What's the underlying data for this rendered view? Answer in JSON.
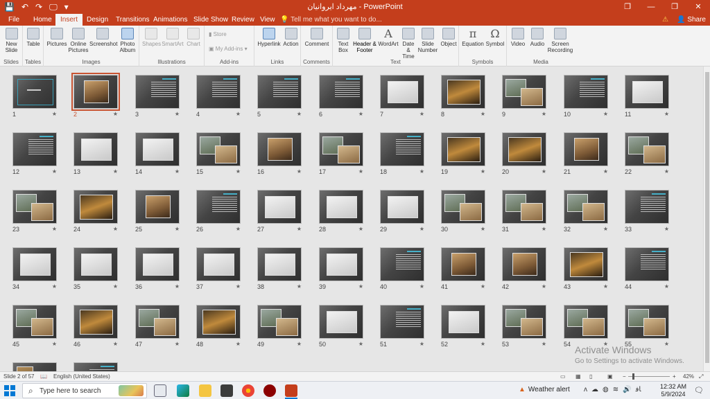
{
  "titlebar": {
    "title": "مهرداد ایروانیان - PowerPoint",
    "qat": [
      "💾",
      "↶",
      "↷",
      "🖵",
      "▾"
    ],
    "window_controls": [
      "❐",
      "—",
      "❐",
      "✕"
    ]
  },
  "tabs": [
    {
      "label": "File",
      "active": false
    },
    {
      "label": "Home",
      "active": false
    },
    {
      "label": "Insert",
      "active": true
    },
    {
      "label": "Design",
      "active": false
    },
    {
      "label": "Transitions",
      "active": false
    },
    {
      "label": "Animations",
      "active": false
    },
    {
      "label": "Slide Show",
      "active": false
    },
    {
      "label": "Review",
      "active": false
    },
    {
      "label": "View",
      "active": false
    }
  ],
  "tell_me": "Tell me what you want to do...",
  "share_label": "Share",
  "ribbon": {
    "new_slide": "New Slide",
    "table": "Table",
    "pictures": "Pictures",
    "online_pictures": "Online Pictures",
    "screenshot": "Screenshot",
    "photo_album": "Photo Album",
    "shapes": "Shapes",
    "smartart": "SmartArt",
    "chart": "Chart",
    "store": "Store",
    "my_addins": "My Add-ins",
    "hyperlink": "Hyperlink",
    "action": "Action",
    "comment": "Comment",
    "text_box": "Text Box",
    "header_footer": "Header & Footer",
    "wordart": "WordArt",
    "date_time": "Date & Time",
    "slide_number": "Slide Number",
    "object": "Object",
    "equation": "Equation",
    "symbol": "Symbol",
    "video": "Video",
    "audio": "Audio",
    "screen_recording": "Screen Recording",
    "groups": {
      "slides": "Slides",
      "tables": "Tables",
      "images": "Images",
      "illustrations": "Illustrations",
      "addins": "Add-ins",
      "links": "Links",
      "comments": "Comments",
      "text": "Text",
      "symbols": "Symbols",
      "media": "Media"
    }
  },
  "slides": [
    {
      "n": "1",
      "k": "frame"
    },
    {
      "n": "2",
      "k": "p1"
    },
    {
      "n": "3",
      "k": "text"
    },
    {
      "n": "4",
      "k": "text"
    },
    {
      "n": "5",
      "k": "text"
    },
    {
      "n": "6",
      "k": "title"
    },
    {
      "n": "7",
      "k": "p4"
    },
    {
      "n": "8",
      "k": "p5"
    },
    {
      "n": "9",
      "k": "two"
    },
    {
      "n": "10",
      "k": "text"
    },
    {
      "n": "11",
      "k": "p4"
    },
    {
      "n": "12",
      "k": "text"
    },
    {
      "n": "13",
      "k": "p4"
    },
    {
      "n": "14",
      "k": "p4"
    },
    {
      "n": "15",
      "k": "two"
    },
    {
      "n": "16",
      "k": "p1"
    },
    {
      "n": "17",
      "k": "two"
    },
    {
      "n": "18",
      "k": "title"
    },
    {
      "n": "19",
      "k": "p5"
    },
    {
      "n": "20",
      "k": "p5"
    },
    {
      "n": "21",
      "k": "p1"
    },
    {
      "n": "22",
      "k": "two"
    },
    {
      "n": "23",
      "k": "two"
    },
    {
      "n": "24",
      "k": "p5"
    },
    {
      "n": "25",
      "k": "p1"
    },
    {
      "n": "26",
      "k": "text"
    },
    {
      "n": "27",
      "k": "p4"
    },
    {
      "n": "28",
      "k": "p4"
    },
    {
      "n": "29",
      "k": "p4"
    },
    {
      "n": "30",
      "k": "two"
    },
    {
      "n": "31",
      "k": "two"
    },
    {
      "n": "32",
      "k": "two"
    },
    {
      "n": "33",
      "k": "text"
    },
    {
      "n": "34",
      "k": "p4"
    },
    {
      "n": "35",
      "k": "p4"
    },
    {
      "n": "36",
      "k": "p4"
    },
    {
      "n": "37",
      "k": "p4"
    },
    {
      "n": "38",
      "k": "p4"
    },
    {
      "n": "39",
      "k": "p4"
    },
    {
      "n": "40",
      "k": "text"
    },
    {
      "n": "41",
      "k": "p1"
    },
    {
      "n": "42",
      "k": "p1"
    },
    {
      "n": "43",
      "k": "p5"
    },
    {
      "n": "44",
      "k": "text"
    },
    {
      "n": "45",
      "k": "two"
    },
    {
      "n": "46",
      "k": "p5"
    },
    {
      "n": "47",
      "k": "two"
    },
    {
      "n": "48",
      "k": "p5"
    },
    {
      "n": "49",
      "k": "two"
    },
    {
      "n": "50",
      "k": "p4"
    },
    {
      "n": "51",
      "k": "text"
    },
    {
      "n": "52",
      "k": "p4"
    },
    {
      "n": "53",
      "k": "two"
    },
    {
      "n": "54",
      "k": "two"
    },
    {
      "n": "55",
      "k": "two"
    },
    {
      "n": "56",
      "k": "p6"
    },
    {
      "n": "57",
      "k": "title"
    }
  ],
  "activate": {
    "line1": "Activate Windows",
    "line2": "Go to Settings to activate Windows."
  },
  "status": {
    "slide_info": "Slide 2 of 57",
    "language": "English (United States)",
    "zoom": "42%"
  },
  "taskbar": {
    "search_placeholder": "Type here to search",
    "weather": "Weather alert",
    "time": "12:32 AM",
    "date": "5/9/2024",
    "lang": "ﺎﻓ"
  }
}
